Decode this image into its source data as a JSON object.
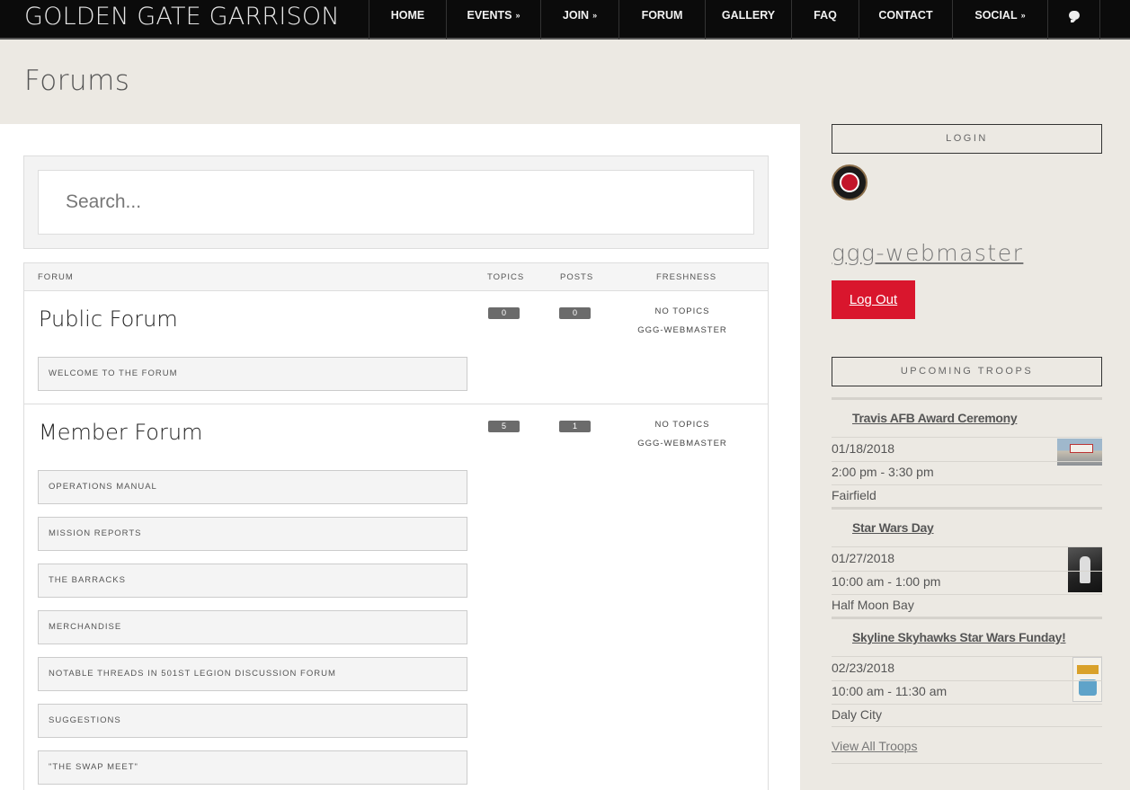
{
  "header": {
    "brand": "GOLDEN GATE GARRISON",
    "nav": [
      {
        "label": "HOME",
        "chevron": false
      },
      {
        "label": "EVENTS",
        "chevron": true
      },
      {
        "label": "JOIN",
        "chevron": true
      },
      {
        "label": "FORUM",
        "chevron": false
      },
      {
        "label": "GALLERY",
        "chevron": false
      },
      {
        "label": "FAQ",
        "chevron": false
      },
      {
        "label": "CONTACT",
        "chevron": false
      },
      {
        "label": "SOCIAL",
        "chevron": true
      }
    ],
    "chat_icon": "comment-icon"
  },
  "page": {
    "title": "Forums"
  },
  "search": {
    "placeholder": "Search..."
  },
  "forum_table": {
    "headers": {
      "forum": "FORUM",
      "topics": "TOPICS",
      "posts": "POSTS",
      "freshness": "FRESHNESS"
    },
    "forums": [
      {
        "name": "Public Forum",
        "topics": "0",
        "posts": "0",
        "freshness": "NO TOPICS",
        "freshness_user": "GGG-WEBMASTER",
        "subforums": [
          "WELCOME TO THE FORUM"
        ]
      },
      {
        "name": "Member Forum",
        "topics": "5",
        "posts": "1",
        "freshness": "NO TOPICS",
        "freshness_user": "GGG-WEBMASTER",
        "subforums": [
          "OPERATIONS MANUAL",
          "MISSION REPORTS",
          "THE BARRACKS",
          "MERCHANDISE",
          "NOTABLE THREADS IN 501ST LEGION DISCUSSION FORUM",
          "SUGGESTIONS",
          "\"THE SWAP MEET\""
        ]
      }
    ]
  },
  "sidebar": {
    "login_title": "LOGIN",
    "username": "ggg-webmaster",
    "logout_label": "Log Out",
    "troops_title": "UPCOMING TROOPS",
    "troops": [
      {
        "title": "Travis AFB Award Ceremony",
        "date": "01/18/2018",
        "time": "2:00 pm - 3:30 pm",
        "location": "Fairfield"
      },
      {
        "title": "Star Wars Day",
        "date": "01/27/2018",
        "time": "10:00 am - 1:00 pm",
        "location": "Half Moon Bay"
      },
      {
        "title": "Skyline Skyhawks Star Wars Funday!",
        "date": "02/23/2018",
        "time": "10:00 am - 11:30 am",
        "location": "Daly City"
      }
    ],
    "view_all_label": "View All Troops"
  },
  "colors": {
    "accent": "#d9162d",
    "header_bg": "#0b0b0b",
    "page_bg": "#ece9e3"
  }
}
